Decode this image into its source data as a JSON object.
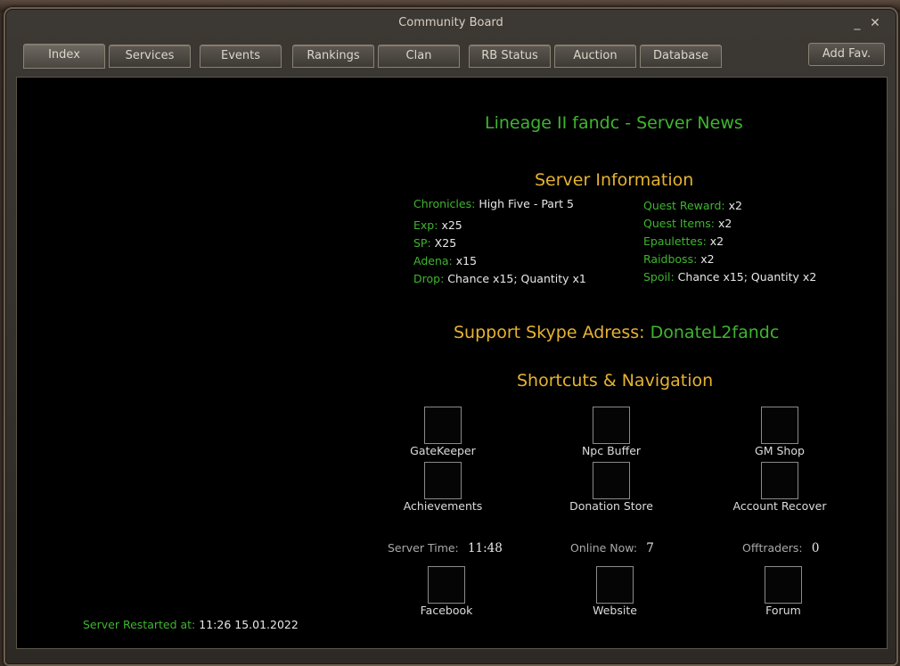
{
  "window": {
    "title": "Community Board",
    "minimize": "_",
    "close": "✕"
  },
  "tabs": [
    {
      "label": "Index"
    },
    {
      "label": "Services"
    },
    {
      "label": "Events"
    },
    {
      "label": "Rankings"
    },
    {
      "label": "Clan"
    },
    {
      "label": "RB Status"
    },
    {
      "label": "Auction"
    },
    {
      "label": "Database"
    }
  ],
  "add_fav_label": "Add Fav.",
  "news_title": "Lineage II fandc - Server News",
  "server_info": {
    "title": "Server Information",
    "left": [
      {
        "label": "Chronicles:",
        "value": "High Five - Part 5"
      },
      {
        "label": "Exp:",
        "value": "x25"
      },
      {
        "label": "SP:",
        "value": "X25"
      },
      {
        "label": "Adena:",
        "value": "x15"
      },
      {
        "label": "Drop:",
        "value": "Chance x15; Quantity x1"
      }
    ],
    "right": [
      {
        "label": "Quest Reward:",
        "value": "x2"
      },
      {
        "label": "Quest Items:",
        "value": "x2"
      },
      {
        "label": "Epaulettes:",
        "value": "x2"
      },
      {
        "label": "Raidboss:",
        "value": "x2"
      },
      {
        "label": "Spoil:",
        "value": "Chance x15; Quantity x2"
      }
    ]
  },
  "support": {
    "label": "Support Skype Adress:",
    "value": "DonateL2fandc"
  },
  "shortcuts": {
    "title": "Shortcuts & Navigation",
    "row1": [
      "GateKeeper",
      "Npc Buffer",
      "GM Shop"
    ],
    "row2": [
      "Achievements",
      "Donation Store",
      "Account Recover"
    ],
    "row3": [
      "Facebook",
      "Website",
      "Forum"
    ]
  },
  "stats": [
    {
      "label": "Server Time:",
      "value": "11:48"
    },
    {
      "label": "Online Now:",
      "value": "7"
    },
    {
      "label": "Offtraders:",
      "value": "0"
    }
  ],
  "restart": {
    "label": "Server Restarted at:",
    "value": "11:26 15.01.2022"
  }
}
